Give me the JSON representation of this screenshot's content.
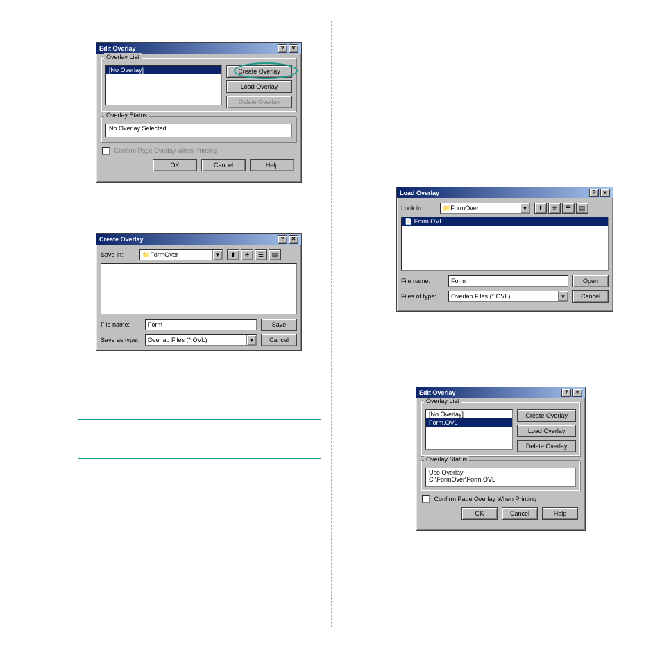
{
  "editOverlay1": {
    "title": "Edit Overlay",
    "overlayListLabel": "Overlay List",
    "listItems": [
      "[No Overlay]"
    ],
    "createOverlay": "Create Overlay",
    "loadOverlay": "Load Overlay",
    "deleteOverlay": "Delete Overlay",
    "overlayStatusLabel": "Overlay Status",
    "statusText": "No Overlay Selected",
    "confirmLabel": "Confirm Page Overlay When Printing",
    "ok": "OK",
    "cancel": "Cancel",
    "help": "Help"
  },
  "createOverlay": {
    "title": "Create Overlay",
    "saveInLabel": "Save in:",
    "folder": "FormOver",
    "fileNameLabel": "File name:",
    "fileName": "Form",
    "saveAsTypeLabel": "Save as type:",
    "saveAsType": "Overlap Files (*.OVL)",
    "save": "Save",
    "cancel": "Cancel"
  },
  "loadOverlay": {
    "title": "Load Overlay",
    "lookInLabel": "Look in:",
    "folder": "FormOver",
    "fileItem": "Form.OVL",
    "fileNameLabel": "File name:",
    "fileName": "Form",
    "filesOfTypeLabel": "Files of type:",
    "filesOfType": "Overlap Files (*.OVL)",
    "open": "Open",
    "cancel": "Cancel"
  },
  "editOverlay2": {
    "title": "Edit Overlay",
    "overlayListLabel": "Overlay List",
    "listItems": [
      "[No Overlay]",
      "Form.OVL"
    ],
    "createOverlay": "Create Overlay",
    "loadOverlay": "Load Overlay",
    "deleteOverlay": "Delete Overlay",
    "overlayStatusLabel": "Overlay Status",
    "statusText1": "Use Overlay",
    "statusText2": "C:\\FormOver\\Form.OVL",
    "confirmLabel": "Confirm Page Overlay When Printing",
    "ok": "OK",
    "cancel": "Cancel",
    "help": "Help"
  },
  "icons": {
    "help": "?",
    "close": "✕",
    "dropdown": "▼",
    "folder": "🗀",
    "up": "📁",
    "new": "✳",
    "list": "☰",
    "details": "▤"
  }
}
